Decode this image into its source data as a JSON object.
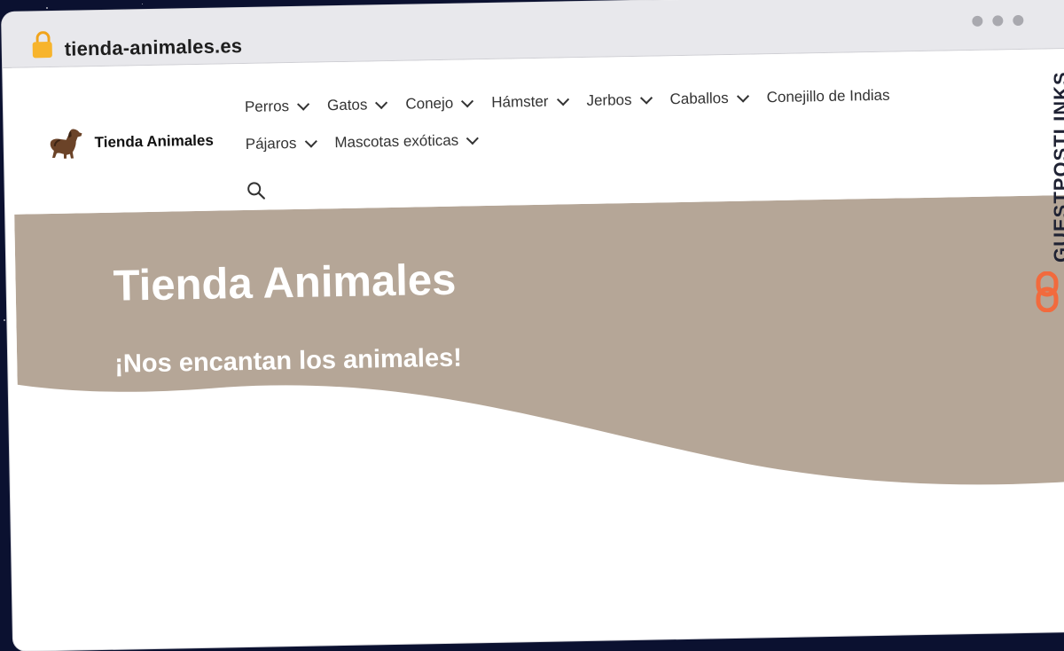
{
  "browser": {
    "url": "tienda-animales.es"
  },
  "site": {
    "logo_text": "Tienda Animales",
    "nav": [
      {
        "label": "Perros",
        "has_dropdown": true
      },
      {
        "label": "Gatos",
        "has_dropdown": true
      },
      {
        "label": "Conejo",
        "has_dropdown": true
      },
      {
        "label": "Hámster",
        "has_dropdown": true
      },
      {
        "label": "Jerbos",
        "has_dropdown": true
      },
      {
        "label": "Caballos",
        "has_dropdown": true
      },
      {
        "label": "Conejillo de Indias",
        "has_dropdown": false
      },
      {
        "label": "Pájaros",
        "has_dropdown": true
      },
      {
        "label": "Mascotas exóticas",
        "has_dropdown": true
      }
    ],
    "search_icon": "search-icon"
  },
  "hero": {
    "title": "Tienda Animales",
    "subtitle": "¡Nos encantan los animales!",
    "background_color": "#b5a697"
  },
  "watermark": {
    "text": "GUESTPOSTLINKS",
    "icon": "chain-link-icon",
    "icon_color": "#f26a3d"
  }
}
